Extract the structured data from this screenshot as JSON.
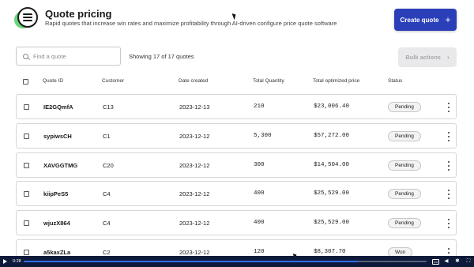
{
  "header": {
    "title": "Quote pricing",
    "subtitle": "Rapid quotes that increase win rates and maximize profitability through AI-driven configure price quote software",
    "create_label": "Create quote",
    "create_icon": "+"
  },
  "toolbar": {
    "search_placeholder": "Find a quote",
    "showing_text": "Showing 17 of 17 quotes",
    "bulk_label": "Bulk actions",
    "bulk_icon": "›"
  },
  "columns": [
    "Quote ID",
    "Customer",
    "Date created",
    "Total Quantity",
    "Total optimized price",
    "Status"
  ],
  "rows": [
    {
      "id": "IE2GQmfA",
      "customer": "C13",
      "date": "2023-12-13",
      "qty": "210",
      "price": "$23,006.40",
      "status": "Pending"
    },
    {
      "id": "sypiwsCH",
      "customer": "C1",
      "date": "2023-12-12",
      "qty": "5,300",
      "price": "$57,272.00",
      "status": "Pending"
    },
    {
      "id": "XAVGGTMG",
      "customer": "C20",
      "date": "2023-12-12",
      "qty": "300",
      "price": "$14,504.00",
      "status": "Pending"
    },
    {
      "id": "kiipPeS5",
      "customer": "C4",
      "date": "2023-12-12",
      "qty": "400",
      "price": "$25,529.00",
      "status": "Pending"
    },
    {
      "id": "wjuzX864",
      "customer": "C4",
      "date": "2023-12-12",
      "qty": "400",
      "price": "$25,529.00",
      "status": "Pending"
    },
    {
      "id": "a5kaxZLa",
      "customer": "C2",
      "date": "2023-12-12",
      "qty": "120",
      "price": "$8,307.70",
      "status": "Won"
    }
  ],
  "video": {
    "time": "0:28",
    "progress": 0.83,
    "colors": {
      "bar": "#0e1a3a",
      "fill": "#2f6df5"
    }
  },
  "colors": {
    "accent": "#2a3fb8",
    "menu_blob": "#5ad06a"
  }
}
